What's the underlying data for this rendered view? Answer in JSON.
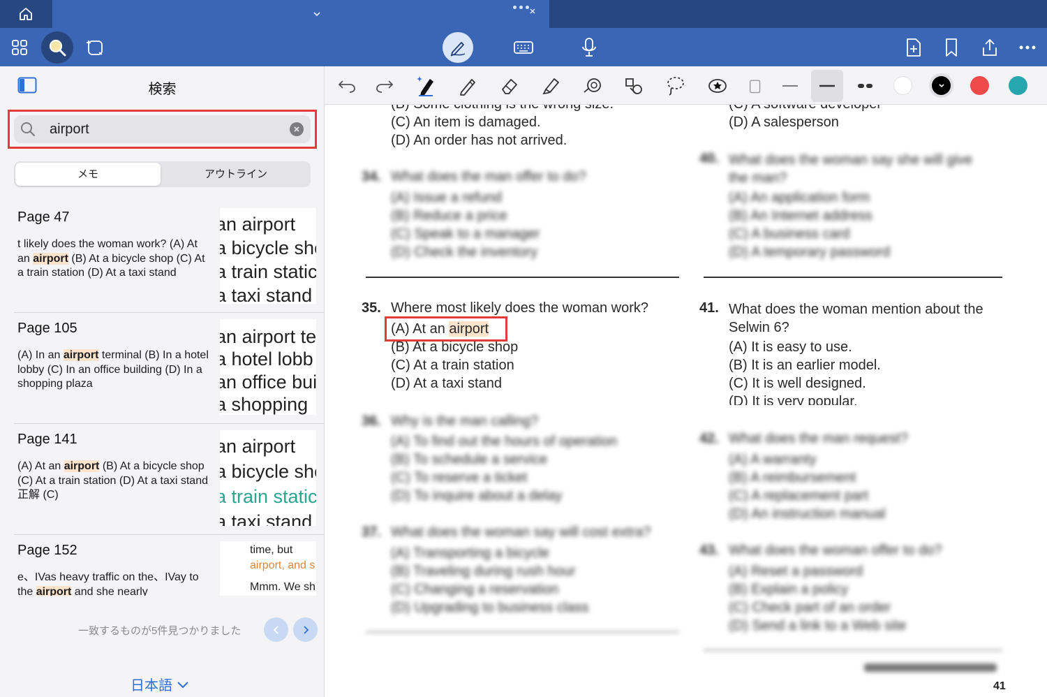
{
  "colors": {
    "accent": "#3b66b5",
    "top_bar": "#26477f",
    "highlight_box": "#e23b3b",
    "match_highlight": "#fbe3cc",
    "link": "#2f6fd4"
  },
  "tab_bar": {
    "home_icon": "home-icon",
    "tab_chevron_icon": "chevron-down-icon",
    "tab_menu_icon": "more-dots-icon"
  },
  "toolbar": {
    "left": [
      "grid-icon",
      "search-icon",
      "lasso-select-icon"
    ],
    "center": [
      "pen-mode-icon",
      "keyboard-icon",
      "microphone-icon"
    ],
    "right": [
      "add-page-icon",
      "bookmark-icon",
      "share-icon",
      "more-icon"
    ]
  },
  "sidebar": {
    "title": "検索",
    "search": {
      "value": "airport",
      "placeholder": ""
    },
    "segments": [
      "メモ",
      "アウトライン"
    ],
    "selected_segment": "メモ",
    "results": [
      {
        "page": "Page 47",
        "snippet_before": "t likely does the woman work? (A) At an ",
        "match": "airport",
        "snippet_after": " (B) At a bicycle shop (C) At a train station (D) At a taxi stand",
        "thumb": [
          "an airport",
          "a bicycle sho",
          "a train static",
          "a taxi stand"
        ]
      },
      {
        "page": "Page 105",
        "snippet_before": "(A) In an ",
        "match": "airport",
        "snippet_after": " terminal (B) In a hotel lobby (C) In an office building (D) In a shopping plaza",
        "thumb": [
          "an airport te",
          "a hotel lobb",
          "an office bui",
          "a shopping"
        ]
      },
      {
        "page": "Page 141",
        "snippet_before": "(A) At an ",
        "match": "airport",
        "snippet_after": " (B) At a bicycle shop (C) At a train station (D) At a taxi stand 正解 (C)",
        "thumb": [
          "an airport",
          "a bicycle sho",
          "a train static",
          "a taxi stand"
        ]
      },
      {
        "page": "Page 152",
        "snippet_before": "e、IVas heavy traffic on the、IVay to the ",
        "match": "airport",
        "snippet_after": " and she nearly",
        "thumb": [
          "time, but",
          "airport, and s",
          "Mmm. We sh"
        ]
      }
    ],
    "match_status": "一致するものが5件見つかりました",
    "language": "日本語"
  },
  "drawing_tools": {
    "tools": [
      "undo-icon",
      "redo-icon",
      "ai-pen-icon",
      "pencil-icon",
      "eraser-icon",
      "highlighter-icon",
      "shape-icon",
      "elements-icon",
      "lasso-icon",
      "sticker-icon",
      "clipboard-icon"
    ],
    "stroke_widths": [
      "thin",
      "medium",
      "dots"
    ],
    "colors": [
      "#ffffff",
      "#000000",
      "#ef4a4a",
      "#26a7ad"
    ]
  },
  "page": {
    "top_left": [
      "(B) Some clothing is the wrong size.",
      "(C) An item is damaged.",
      "(D) An order has not arrived."
    ],
    "top_right": [
      "(C) A software developer",
      "(D) A salesperson"
    ],
    "q34": {
      "num": "34.",
      "text": "What does the man offer to do?",
      "options": [
        "(A) Issue a refund",
        "(B) Reduce a price",
        "(C) Speak to a manager",
        "(D) Check the inventory"
      ]
    },
    "q40": {
      "num": "40.",
      "text": "What does the woman say she will give the man?",
      "options": [
        "(A) An application form",
        "(B) An Internet address",
        "(C) A business card",
        "(D) A temporary password"
      ]
    },
    "q35": {
      "num": "35.",
      "text": "Where most likely does the woman work?",
      "opt_a_before": "(A) At an ",
      "opt_a_match": "airport",
      "options": [
        "(B) At a bicycle shop",
        "(C) At a train station",
        "(D) At a taxi stand"
      ]
    },
    "q41": {
      "num": "41.",
      "text": "What does the woman mention about the Selwin 6?",
      "options": [
        "(A) It is easy to use.",
        "(B) It is an earlier model.",
        "(C) It is well designed.",
        "(D) It is very popular."
      ]
    },
    "q36": {
      "num": "36.",
      "text": "Why is the man calling?",
      "options": [
        "(A) To find out the hours of operation",
        "(B) To schedule a service",
        "(C) To reserve a ticket",
        "(D) To inquire about a delay"
      ]
    },
    "q42": {
      "num": "42.",
      "text": "What does the man request?",
      "options": [
        "(A) A warranty",
        "(B) A reimbursement",
        "(C) A replacement part",
        "(D) An instruction manual"
      ]
    },
    "q37": {
      "num": "37.",
      "text": "What does the woman say will cost extra?",
      "options": [
        "(A) Transporting a bicycle",
        "(B) Traveling during rush hour",
        "(C) Changing a reservation",
        "(D) Upgrading to business class"
      ]
    },
    "q43": {
      "num": "43.",
      "text": "What does the woman offer to do?",
      "options": [
        "(A) Reset a password",
        "(B) Explain a policy",
        "(C) Check part of an order",
        "(D) Send a link to a Web site"
      ]
    },
    "page_number": "41"
  }
}
